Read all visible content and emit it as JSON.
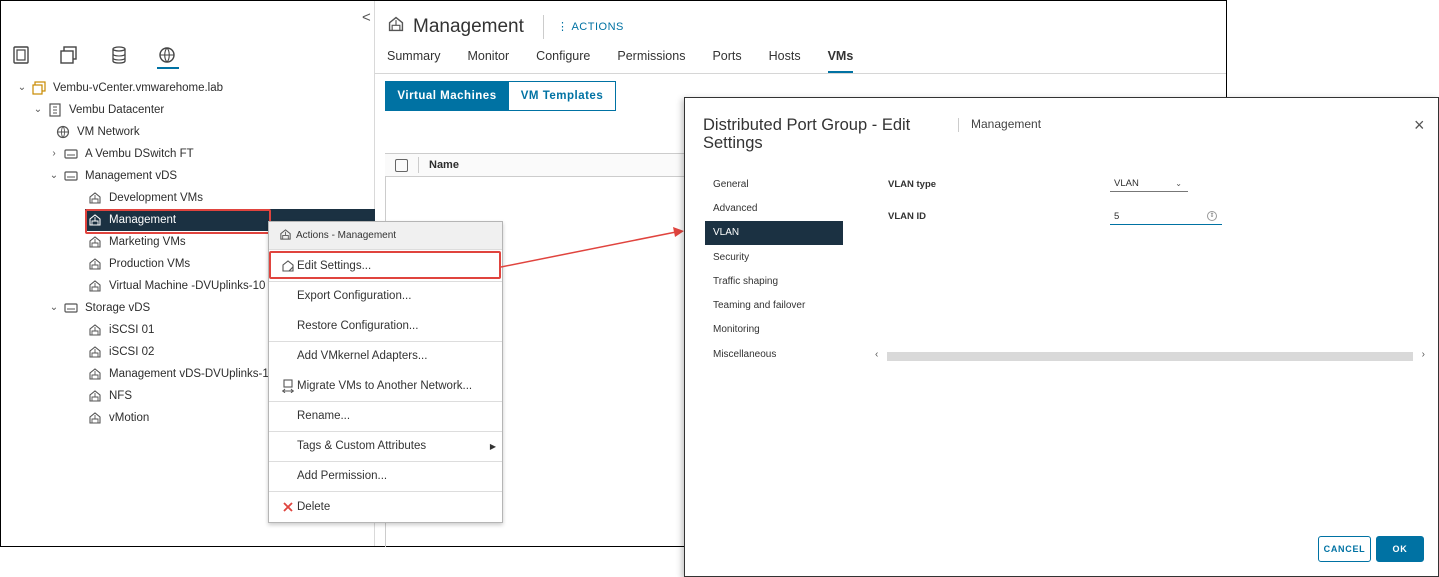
{
  "navigator": {
    "collapse_glyph": "<",
    "tree": [
      {
        "label": "Vembu-vCenter.vmwarehome.lab",
        "icon": "vcenter-icon",
        "expanded": true
      },
      {
        "label": "Vembu Datacenter",
        "icon": "datacenter-icon",
        "expanded": true
      },
      {
        "label": "VM Network",
        "icon": "network-icon"
      },
      {
        "label": "A Vembu DSwitch FT",
        "icon": "dswitch-icon",
        "expanded": false
      },
      {
        "label": "Management vDS",
        "icon": "dswitch-icon",
        "expanded": true
      },
      {
        "label": "Development VMs",
        "icon": "portgroup-icon"
      },
      {
        "label": "Management",
        "icon": "portgroup-icon",
        "selected": true
      },
      {
        "label": "Marketing VMs",
        "icon": "portgroup-icon"
      },
      {
        "label": "Production VMs",
        "icon": "portgroup-icon"
      },
      {
        "label": "Virtual Machine -DVUplinks-10",
        "icon": "portgroup-icon"
      },
      {
        "label": "Storage vDS",
        "icon": "dswitch-icon",
        "expanded": true
      },
      {
        "label": "iSCSI 01",
        "icon": "portgroup-icon"
      },
      {
        "label": "iSCSI 02",
        "icon": "portgroup-icon"
      },
      {
        "label": "Management vDS-DVUplinks-1",
        "icon": "portgroup-icon"
      },
      {
        "label": "NFS",
        "icon": "portgroup-icon"
      },
      {
        "label": "vMotion",
        "icon": "portgroup-icon"
      }
    ]
  },
  "content": {
    "title": "Management",
    "actions_label": "ACTIONS",
    "tabs": [
      "Summary",
      "Monitor",
      "Configure",
      "Permissions",
      "Ports",
      "Hosts",
      "VMs"
    ],
    "active_tab": "VMs",
    "segments": [
      "Virtual Machines",
      "VM Templates"
    ],
    "grid_column": "Name"
  },
  "context_menu": {
    "header": "Actions - Management",
    "items": [
      "Edit Settings...",
      "Export Configuration...",
      "Restore Configuration...",
      "Add VMkernel Adapters...",
      "Migrate VMs to Another Network...",
      "Rename...",
      "Tags & Custom Attributes",
      "Add Permission...",
      "Delete"
    ]
  },
  "dialog": {
    "title": "Distributed Port Group - Edit Settings",
    "subtitle": "Management",
    "close_glyph": "×",
    "menu": [
      "General",
      "Advanced",
      "VLAN",
      "Security",
      "Traffic shaping",
      "Teaming and failover",
      "Monitoring",
      "Miscellaneous"
    ],
    "active_menu": "VLAN",
    "vlan_type_label": "VLAN type",
    "vlan_type_value": "VLAN",
    "vlan_id_label": "VLAN ID",
    "vlan_id_value": "5",
    "cancel_label": "CANCEL",
    "ok_label": "OK"
  },
  "colors": {
    "accent": "#0072a3",
    "selection": "#1b3142",
    "highlight_box": "#e0443e"
  }
}
